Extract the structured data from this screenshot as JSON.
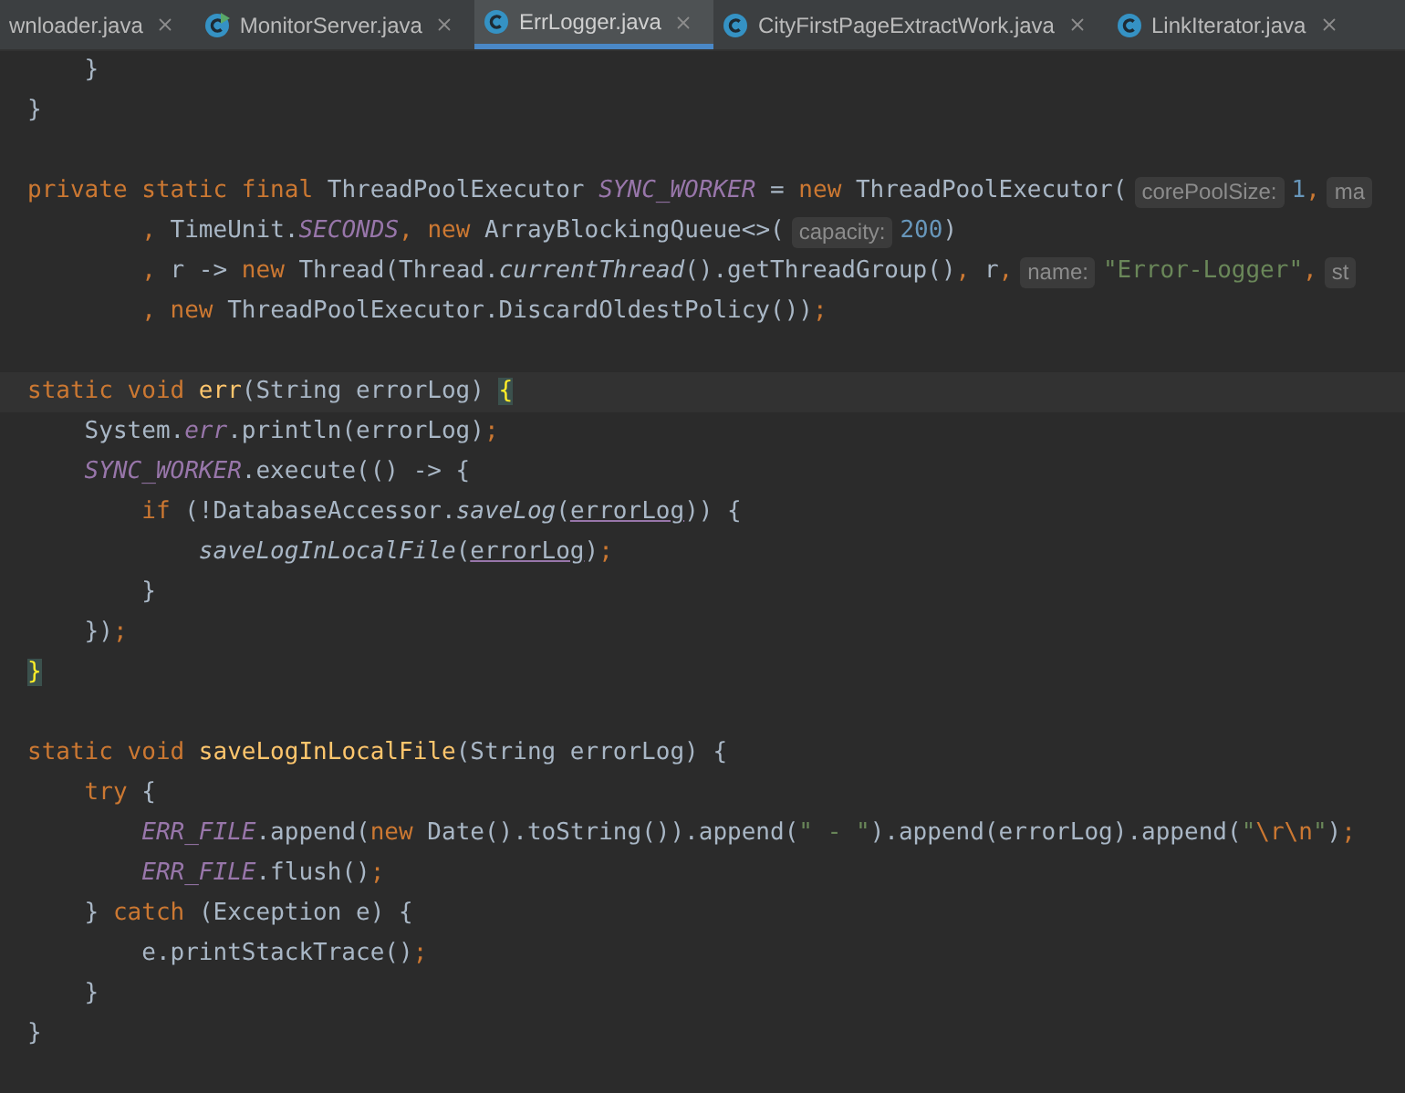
{
  "tabs": [
    {
      "label": "wnloader.java",
      "kind": "plain",
      "selected": false
    },
    {
      "label": "MonitorServer.java",
      "kind": "runnable-class",
      "selected": false
    },
    {
      "label": "ErrLogger.java",
      "kind": "class",
      "selected": true
    },
    {
      "label": "CityFirstPageExtractWork.java",
      "kind": "class",
      "selected": false
    },
    {
      "label": "LinkIterator.java",
      "kind": "class",
      "selected": false
    }
  ],
  "lines": [
    {
      "kind": "code",
      "segments": [
        {
          "kind": "code",
          "tokens": [
            {
              "text": "    }",
              "kind": "plain"
            }
          ]
        }
      ]
    },
    {
      "kind": "code",
      "segments": [
        {
          "kind": "code",
          "tokens": [
            {
              "text": "}",
              "kind": "plain"
            }
          ]
        }
      ]
    },
    {
      "kind": "blank"
    },
    {
      "kind": "code",
      "segments": [
        {
          "kind": "code",
          "tokens": [
            {
              "text": "private static final ",
              "kind": "keyword"
            },
            {
              "text": "ThreadPoolExecutor ",
              "kind": "plain"
            },
            {
              "text": "SYNC_WORKER",
              "kind": "constant"
            },
            {
              "text": " = ",
              "kind": "plain"
            },
            {
              "text": "new ",
              "kind": "keyword"
            },
            {
              "text": "ThreadPoolExecutor(",
              "kind": "plain"
            }
          ]
        },
        {
          "kind": "hint",
          "text": "corePoolSize:"
        },
        {
          "kind": "code",
          "tokens": [
            {
              "text": "1",
              "kind": "number"
            },
            {
              "text": ",",
              "kind": "punct"
            }
          ]
        },
        {
          "kind": "hint",
          "text": "ma"
        }
      ]
    },
    {
      "kind": "code",
      "segments": [
        {
          "kind": "code",
          "tokens": [
            {
              "text": "        , ",
              "kind": "punct"
            },
            {
              "text": "TimeUnit.",
              "kind": "plain"
            },
            {
              "text": "SECONDS",
              "kind": "constant"
            },
            {
              "text": ", ",
              "kind": "punct"
            },
            {
              "text": "new ",
              "kind": "keyword"
            },
            {
              "text": "ArrayBlockingQueue<>(",
              "kind": "plain"
            }
          ]
        },
        {
          "kind": "hint",
          "text": "capacity:"
        },
        {
          "kind": "code",
          "tokens": [
            {
              "text": "200",
              "kind": "number"
            },
            {
              "text": ")",
              "kind": "plain"
            }
          ]
        }
      ]
    },
    {
      "kind": "code",
      "segments": [
        {
          "kind": "code",
          "tokens": [
            {
              "text": "        , ",
              "kind": "punct"
            },
            {
              "text": "r -> ",
              "kind": "plain"
            },
            {
              "text": "new ",
              "kind": "keyword"
            },
            {
              "text": "Thread(Thread.",
              "kind": "plain"
            },
            {
              "text": "currentThread",
              "kind": "static-call"
            },
            {
              "text": "().getThreadGroup()",
              "kind": "plain"
            },
            {
              "text": ", ",
              "kind": "punct"
            },
            {
              "text": "r",
              "kind": "plain"
            },
            {
              "text": ",",
              "kind": "punct"
            }
          ]
        },
        {
          "kind": "hint",
          "text": "name:"
        },
        {
          "kind": "code",
          "tokens": [
            {
              "text": "\"Error-Logger\"",
              "kind": "string"
            },
            {
              "text": ",",
              "kind": "punct"
            }
          ]
        },
        {
          "kind": "hint",
          "text": "st"
        }
      ]
    },
    {
      "kind": "code",
      "segments": [
        {
          "kind": "code",
          "tokens": [
            {
              "text": "        , ",
              "kind": "punct"
            },
            {
              "text": "new ",
              "kind": "keyword"
            },
            {
              "text": "ThreadPoolExecutor.DiscardOldestPolicy())",
              "kind": "plain"
            },
            {
              "text": ";",
              "kind": "punct"
            }
          ]
        }
      ]
    },
    {
      "kind": "blank"
    },
    {
      "kind": "current",
      "segments": [
        {
          "kind": "code",
          "tokens": [
            {
              "text": "static void ",
              "kind": "keyword"
            },
            {
              "text": "err",
              "kind": "declaration"
            },
            {
              "text": "(String errorLog) ",
              "kind": "plain"
            },
            {
              "text": "{",
              "kind": "brace-match"
            }
          ]
        }
      ]
    },
    {
      "kind": "code",
      "segments": [
        {
          "kind": "code",
          "tokens": [
            {
              "text": "    System.",
              "kind": "plain"
            },
            {
              "text": "err",
              "kind": "constant"
            },
            {
              "text": ".println(errorLog)",
              "kind": "plain"
            },
            {
              "text": ";",
              "kind": "punct"
            }
          ]
        }
      ]
    },
    {
      "kind": "code",
      "segments": [
        {
          "kind": "code",
          "tokens": [
            {
              "text": "    SYNC_WORKER",
              "kind": "constant"
            },
            {
              "text": ".execute(() -> {",
              "kind": "plain"
            }
          ]
        }
      ]
    },
    {
      "kind": "code",
      "segments": [
        {
          "kind": "code",
          "tokens": [
            {
              "text": "        if ",
              "kind": "keyword"
            },
            {
              "text": "(!DatabaseAccessor.",
              "kind": "plain"
            },
            {
              "text": "saveLog",
              "kind": "static-call"
            },
            {
              "text": "(",
              "kind": "plain"
            },
            {
              "text": "errorLog",
              "kind": "param"
            },
            {
              "text": ")) {",
              "kind": "plain"
            }
          ]
        }
      ]
    },
    {
      "kind": "code",
      "segments": [
        {
          "kind": "code",
          "tokens": [
            {
              "text": "            saveLogInLocalFile",
              "kind": "static-call"
            },
            {
              "text": "(",
              "kind": "plain"
            },
            {
              "text": "errorLog",
              "kind": "param"
            },
            {
              "text": ")",
              "kind": "plain"
            },
            {
              "text": ";",
              "kind": "punct"
            }
          ]
        }
      ]
    },
    {
      "kind": "code",
      "segments": [
        {
          "kind": "code",
          "tokens": [
            {
              "text": "        }",
              "kind": "plain"
            }
          ]
        }
      ]
    },
    {
      "kind": "code",
      "segments": [
        {
          "kind": "code",
          "tokens": [
            {
              "text": "    })",
              "kind": "plain"
            },
            {
              "text": ";",
              "kind": "punct"
            }
          ]
        }
      ]
    },
    {
      "kind": "code",
      "segments": [
        {
          "kind": "code",
          "tokens": [
            {
              "text": "}",
              "kind": "brace-match"
            }
          ]
        }
      ]
    },
    {
      "kind": "blank"
    },
    {
      "kind": "code",
      "segments": [
        {
          "kind": "code",
          "tokens": [
            {
              "text": "static void ",
              "kind": "keyword"
            },
            {
              "text": "saveLogInLocalFile",
              "kind": "declaration"
            },
            {
              "text": "(String errorLog) {",
              "kind": "plain"
            }
          ]
        }
      ]
    },
    {
      "kind": "code",
      "segments": [
        {
          "kind": "code",
          "tokens": [
            {
              "text": "    try ",
              "kind": "keyword"
            },
            {
              "text": "{",
              "kind": "plain"
            }
          ]
        }
      ]
    },
    {
      "kind": "code",
      "segments": [
        {
          "kind": "code",
          "tokens": [
            {
              "text": "        ERR_FILE",
              "kind": "constant"
            },
            {
              "text": ".append(",
              "kind": "plain"
            },
            {
              "text": "new ",
              "kind": "keyword"
            },
            {
              "text": "Date().toString()).append(",
              "kind": "plain"
            },
            {
              "text": "\" - \"",
              "kind": "string"
            },
            {
              "text": ").append(errorLog).append(",
              "kind": "plain"
            },
            {
              "text": "\"",
              "kind": "string"
            },
            {
              "text": "\\r\\n",
              "kind": "escape"
            },
            {
              "text": "\"",
              "kind": "string"
            },
            {
              "text": ")",
              "kind": "plain"
            },
            {
              "text": ";",
              "kind": "punct"
            }
          ]
        }
      ]
    },
    {
      "kind": "code",
      "segments": [
        {
          "kind": "code",
          "tokens": [
            {
              "text": "        ERR_FILE",
              "kind": "constant"
            },
            {
              "text": ".flush()",
              "kind": "plain"
            },
            {
              "text": ";",
              "kind": "punct"
            }
          ]
        }
      ]
    },
    {
      "kind": "code",
      "segments": [
        {
          "kind": "code",
          "tokens": [
            {
              "text": "    } ",
              "kind": "plain"
            },
            {
              "text": "catch ",
              "kind": "keyword"
            },
            {
              "text": "(Exception e) {",
              "kind": "plain"
            }
          ]
        }
      ]
    },
    {
      "kind": "code",
      "segments": [
        {
          "kind": "code",
          "tokens": [
            {
              "text": "        e.printStackTrace()",
              "kind": "plain"
            },
            {
              "text": ";",
              "kind": "punct"
            }
          ]
        }
      ]
    },
    {
      "kind": "code",
      "segments": [
        {
          "kind": "code",
          "tokens": [
            {
              "text": "    }",
              "kind": "plain"
            }
          ]
        }
      ]
    },
    {
      "kind": "code",
      "segments": [
        {
          "kind": "code",
          "tokens": [
            {
              "text": "}",
              "kind": "plain"
            }
          ]
        }
      ]
    }
  ]
}
